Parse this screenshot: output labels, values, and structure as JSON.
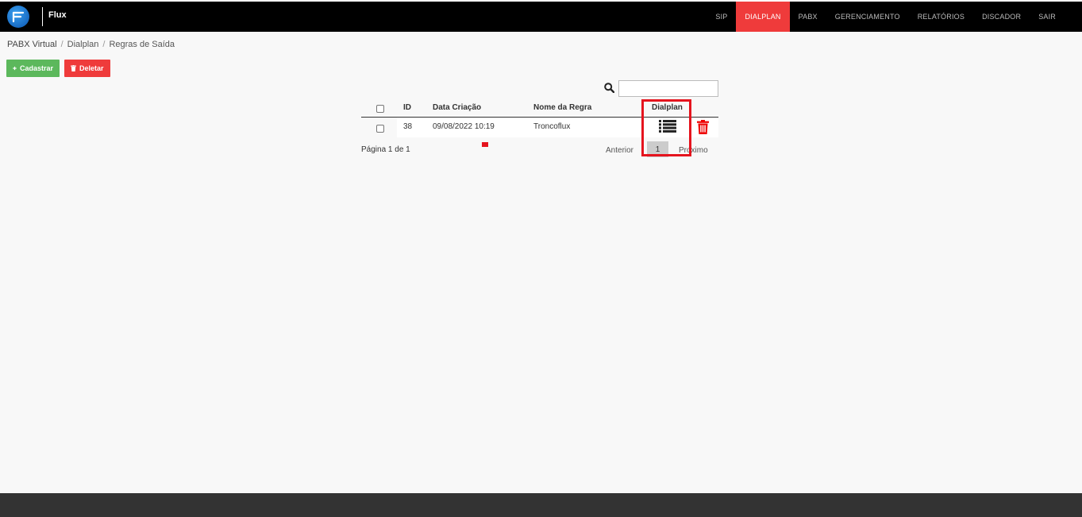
{
  "brand": {
    "name": "Flux"
  },
  "nav": {
    "items": [
      {
        "label": "SIP",
        "active": false
      },
      {
        "label": "DIALPLAN",
        "active": true
      },
      {
        "label": "PABX",
        "active": false
      },
      {
        "label": "GERENCIAMENTO",
        "active": false
      },
      {
        "label": "RELATÓRIOS",
        "active": false
      },
      {
        "label": "DISCADOR",
        "active": false
      },
      {
        "label": "SAIR",
        "active": false
      }
    ]
  },
  "breadcrumb": {
    "items": [
      "PABX Virtual",
      "Dialplan",
      "Regras de Saída"
    ]
  },
  "toolbar": {
    "cadastrar_label": "Cadastrar",
    "deletar_label": "Deletar"
  },
  "search": {
    "value": "",
    "placeholder": ""
  },
  "table": {
    "headers": {
      "id": "ID",
      "date": "Data Criação",
      "name": "Nome da Regra",
      "dialplan": "Dialplan"
    },
    "rows": [
      {
        "id": "38",
        "date": "09/08/2022 10:19",
        "name": "Troncoflux"
      }
    ]
  },
  "pagination": {
    "info": "Página 1 de 1",
    "prev": "Anterior",
    "page": "1",
    "next": "Proximo"
  },
  "colors": {
    "accent": "#ef3b3b",
    "success": "#5cb85c",
    "highlight": "#e5141e"
  }
}
